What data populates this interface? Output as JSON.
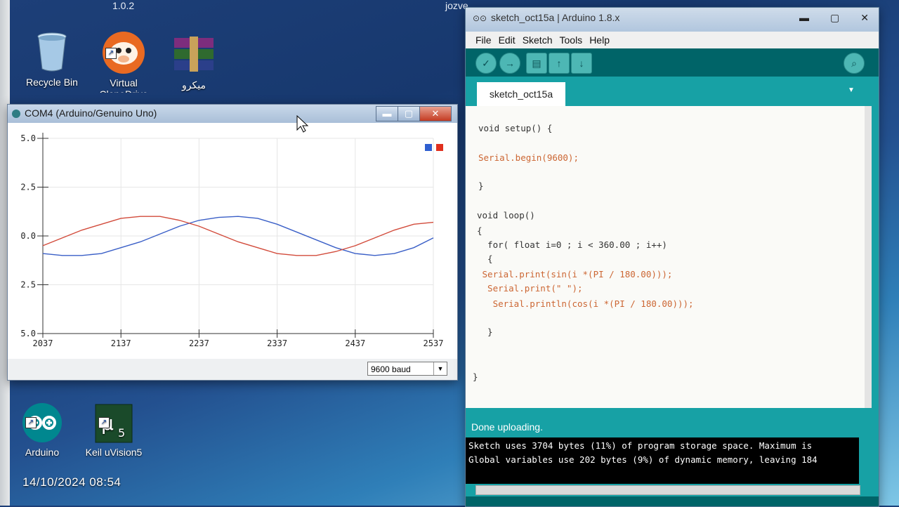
{
  "desktop": {
    "top_version": "1.0.2",
    "top_user": "jozve",
    "icons": [
      {
        "label": "Recycle Bin"
      },
      {
        "label": "Virtual CloneDrive"
      },
      {
        "label": "میکرو"
      },
      {
        "label": "Arduino"
      },
      {
        "label": "Keil uVision5"
      }
    ],
    "timestamp": "14/10/2024  08:54"
  },
  "plotter": {
    "title": "COM4 (Arduino/Genuino Uno)",
    "baud": "9600 baud",
    "legend_colors": [
      "#2f5fd0",
      "#e0301e"
    ]
  },
  "chart_data": {
    "type": "line",
    "x": [
      2037,
      2062,
      2087,
      2112,
      2137,
      2162,
      2187,
      2212,
      2237,
      2262,
      2287,
      2312,
      2337,
      2362,
      2387,
      2412,
      2437,
      2462,
      2487,
      2512,
      2537
    ],
    "series": [
      {
        "values": [
          -0.9,
          -1.0,
          -1.0,
          -0.9,
          -0.6,
          -0.3,
          0.1,
          0.5,
          0.8,
          0.95,
          1.0,
          0.9,
          0.6,
          0.2,
          -0.2,
          -0.6,
          -0.9,
          -1.0,
          -0.9,
          -0.6,
          -0.1
        ],
        "color": "#3a5fc7"
      },
      {
        "values": [
          -0.5,
          -0.1,
          0.3,
          0.6,
          0.9,
          1.0,
          1.0,
          0.8,
          0.5,
          0.1,
          -0.3,
          -0.6,
          -0.9,
          -1.0,
          -1.0,
          -0.8,
          -0.5,
          -0.1,
          0.3,
          0.6,
          0.7
        ],
        "color": "#d24b3b"
      }
    ],
    "xticks": [
      "2037",
      "2137",
      "2237",
      "2337",
      "2437",
      "2537"
    ],
    "yticks": [
      "5.0",
      "2.5",
      "0.0",
      "2.5",
      "5.0"
    ],
    "ylim": [
      -5,
      5
    ],
    "xlim": [
      2037,
      2537
    ],
    "grid": true,
    "legend": "top-right"
  },
  "ide": {
    "title": "sketch_oct15a | Arduino 1.8.x",
    "menu": [
      "File",
      "Edit",
      "Sketch",
      "Tools",
      "Help"
    ],
    "tab": "sketch_oct15a",
    "code": [
      "void setup() {",
      "Serial.begin(9600);",
      "}",
      "void loop()",
      "{",
      "  for( float i=0 ; i < 360.00 ; i++)",
      "  {",
      " Serial.print(sin(i *(PI / 180.00)));",
      "  Serial.print(\" \");",
      "   Serial.println(cos(i *(PI / 180.00)));",
      "  }",
      "}"
    ],
    "status": "Done uploading.",
    "console": [
      "Sketch uses 3704 bytes (11%) of program storage space. Maximum is",
      "Global variables use 202 bytes (9%) of dynamic memory, leaving 184"
    ]
  }
}
